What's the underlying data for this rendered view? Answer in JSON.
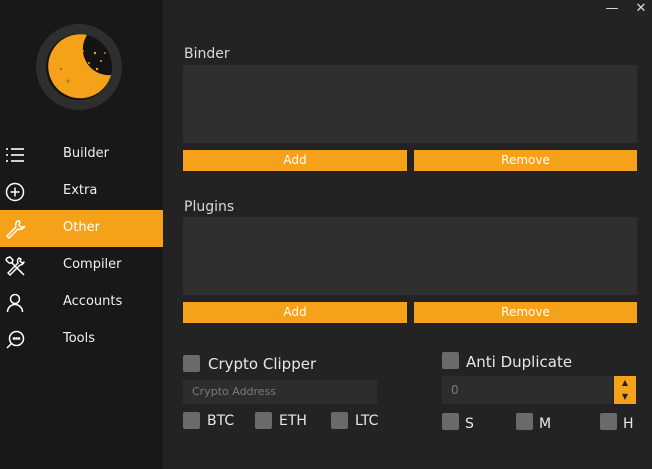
{
  "window": {
    "minimize_glyph": "—",
    "close_glyph": "✕"
  },
  "sidebar": {
    "items": [
      {
        "label": "Builder",
        "icon": "list-icon",
        "active": false
      },
      {
        "label": "Extra",
        "icon": "plus-circle-icon",
        "active": false
      },
      {
        "label": "Other",
        "icon": "wrench-icon",
        "active": true
      },
      {
        "label": "Compiler",
        "icon": "tools-icon",
        "active": false
      },
      {
        "label": "Accounts",
        "icon": "user-icon",
        "active": false
      },
      {
        "label": "Tools",
        "icon": "chat-search-icon",
        "active": false
      }
    ]
  },
  "binder": {
    "title": "Binder",
    "add_label": "Add",
    "remove_label": "Remove"
  },
  "plugins": {
    "title": "Plugins",
    "add_label": "Add",
    "remove_label": "Remove"
  },
  "crypto": {
    "label": "Crypto Clipper",
    "address_placeholder": "Crypto Address",
    "coins": [
      "BTC",
      "ETH",
      "LTC"
    ]
  },
  "duplicate": {
    "label": "Anti Duplicate",
    "value": "0",
    "options": [
      "S",
      "M",
      "H"
    ]
  },
  "colors": {
    "accent": "#f5a11a",
    "sidebar": "#181818",
    "background": "#232323",
    "panel": "#2f2f2f"
  }
}
